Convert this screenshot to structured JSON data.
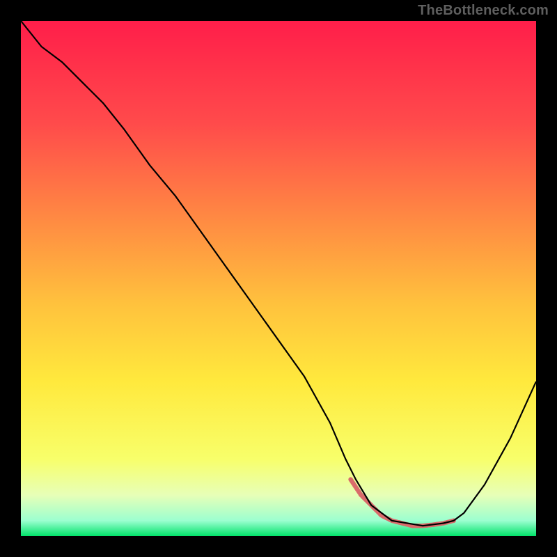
{
  "watermark": "TheBottleneck.com",
  "chart_data": {
    "type": "line",
    "title": "",
    "xlabel": "",
    "ylabel": "",
    "xlim": [
      0,
      100
    ],
    "ylim": [
      0,
      100
    ],
    "grid": false,
    "series": [
      {
        "name": "curve",
        "x": [
          0,
          4,
          8,
          12,
          16,
          20,
          25,
          30,
          35,
          40,
          45,
          50,
          55,
          60,
          63,
          65,
          68,
          72,
          78,
          82,
          84,
          86,
          90,
          95,
          100
        ],
        "values": [
          100,
          95,
          92,
          88,
          84,
          79,
          72,
          66,
          59,
          52,
          45,
          38,
          31,
          22,
          15,
          11,
          6,
          3,
          2,
          2.5,
          3,
          4.5,
          10,
          19,
          30
        ]
      },
      {
        "name": "highlight",
        "x": [
          64,
          66,
          68,
          70,
          72,
          74,
          76,
          78,
          80,
          82,
          84
        ],
        "values": [
          11,
          8,
          6,
          4,
          3,
          2.5,
          2,
          2,
          2.2,
          2.5,
          3
        ]
      }
    ],
    "gradient": {
      "stops": [
        {
          "offset": 0.0,
          "color": "#ff1e4a"
        },
        {
          "offset": 0.2,
          "color": "#ff4b4b"
        },
        {
          "offset": 0.4,
          "color": "#ff8f42"
        },
        {
          "offset": 0.55,
          "color": "#ffc23d"
        },
        {
          "offset": 0.7,
          "color": "#ffe93d"
        },
        {
          "offset": 0.85,
          "color": "#f8ff6a"
        },
        {
          "offset": 0.92,
          "color": "#e7ffb7"
        },
        {
          "offset": 0.97,
          "color": "#9cffd0"
        },
        {
          "offset": 1.0,
          "color": "#00e36a"
        }
      ]
    },
    "styles": {
      "curve_stroke": "#000000",
      "curve_width": 2.2,
      "highlight_stroke": "#d96b6b",
      "highlight_width": 6.5
    }
  }
}
